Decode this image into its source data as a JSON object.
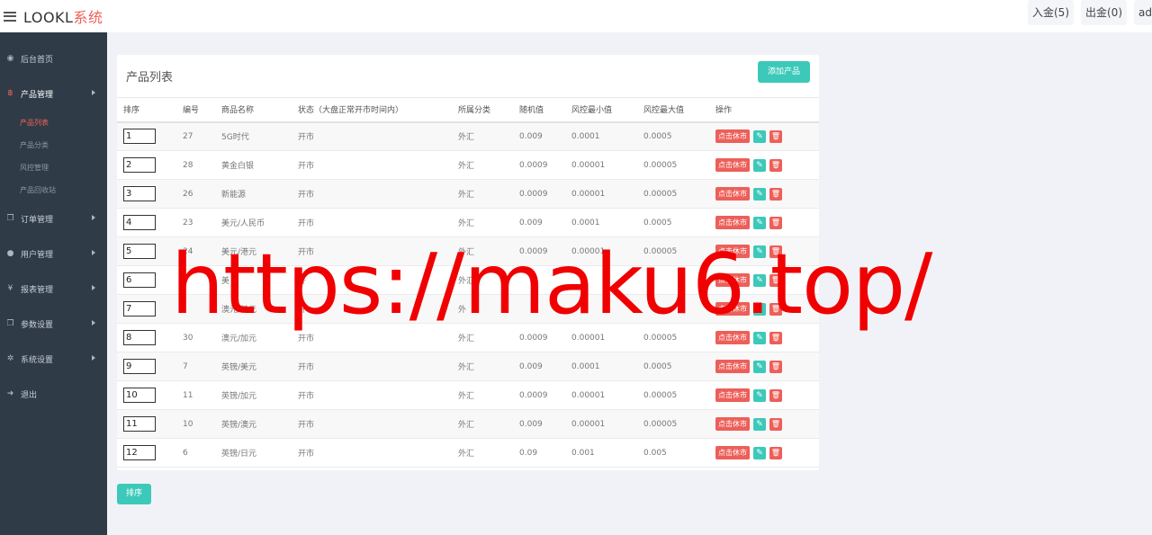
{
  "brand": {
    "main": "LOOKL",
    "accent": "系统"
  },
  "top_buttons": {
    "deposit": "入金(5)",
    "withdraw": "出金(0)",
    "user": "admin"
  },
  "sidebar": {
    "items": [
      {
        "label": "后台首页",
        "icon": "dashboard-icon"
      },
      {
        "label": "产品管理",
        "icon": "bitcoin-icon"
      },
      {
        "label": "订单管理",
        "icon": "copy-icon"
      },
      {
        "label": "用户管理",
        "icon": "user-icon"
      },
      {
        "label": "报表管理",
        "icon": "yen-icon"
      },
      {
        "label": "参数设置",
        "icon": "copy-icon"
      },
      {
        "label": "系统设置",
        "icon": "gears-icon"
      },
      {
        "label": "退出",
        "icon": "sign-out-icon"
      }
    ],
    "subitems": [
      "产品列表",
      "产品分类",
      "风控管理",
      "产品回收站"
    ]
  },
  "panel": {
    "title": "产品列表",
    "add_label": "添加产品"
  },
  "table": {
    "headers": [
      "排序",
      "编号",
      "商品名称",
      "状态（大盘正常开市时间内）",
      "所属分类",
      "随机值",
      "风控最小值",
      "风控最大值",
      "操作"
    ],
    "rows": [
      {
        "sort": "1",
        "id": "27",
        "name": "5G时代",
        "status": "开市",
        "category": "外汇",
        "random": "0.009",
        "min": "0.0001",
        "max": "0.0005"
      },
      {
        "sort": "2",
        "id": "28",
        "name": "黄金白银",
        "status": "开市",
        "category": "外汇",
        "random": "0.0009",
        "min": "0.00001",
        "max": "0.00005"
      },
      {
        "sort": "3",
        "id": "26",
        "name": "新能源",
        "status": "开市",
        "category": "外汇",
        "random": "0.0009",
        "min": "0.00001",
        "max": "0.00005"
      },
      {
        "sort": "4",
        "id": "23",
        "name": "美元/人民币",
        "status": "开市",
        "category": "外汇",
        "random": "0.009",
        "min": "0.0001",
        "max": "0.0005"
      },
      {
        "sort": "5",
        "id": "24",
        "name": "美元/港元",
        "status": "开市",
        "category": "外汇",
        "random": "0.0009",
        "min": "0.00001",
        "max": "0.00005"
      },
      {
        "sort": "6",
        "id": "",
        "name": "美",
        "status": "开",
        "category": "外汇",
        "random": "",
        "min": "",
        "max": ""
      },
      {
        "sort": "7",
        "id": "",
        "name": "澳元/美元",
        "status": "开",
        "category": "外",
        "random": "",
        "min": "",
        "max": ""
      },
      {
        "sort": "8",
        "id": "30",
        "name": "澳元/加元",
        "status": "开市",
        "category": "外汇",
        "random": "0.0009",
        "min": "0.00001",
        "max": "0.00005"
      },
      {
        "sort": "9",
        "id": "7",
        "name": "英镑/美元",
        "status": "开市",
        "category": "外汇",
        "random": "0.009",
        "min": "0.0001",
        "max": "0.0005"
      },
      {
        "sort": "10",
        "id": "11",
        "name": "英镑/加元",
        "status": "开市",
        "category": "外汇",
        "random": "0.0009",
        "min": "0.00001",
        "max": "0.00005"
      },
      {
        "sort": "11",
        "id": "10",
        "name": "英镑/澳元",
        "status": "开市",
        "category": "外汇",
        "random": "0.009",
        "min": "0.00001",
        "max": "0.00005"
      },
      {
        "sort": "12",
        "id": "6",
        "name": "英镑/日元",
        "status": "开市",
        "category": "外汇",
        "random": "0.09",
        "min": "0.001",
        "max": "0.005"
      }
    ],
    "close_label": "点击休市"
  },
  "sort_button": "排序",
  "watermark": "https://maku6.top/",
  "colors": {
    "accent_red": "#f0605a",
    "teal": "#3cc9b9",
    "sidebar": "#2f3b47"
  }
}
